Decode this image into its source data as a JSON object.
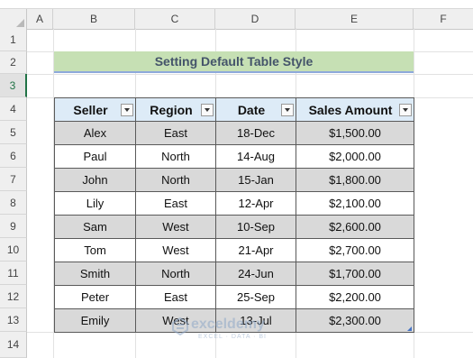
{
  "columns": [
    "A",
    "B",
    "C",
    "D",
    "E",
    "F"
  ],
  "rows": [
    "1",
    "2",
    "3",
    "4",
    "5",
    "6",
    "7",
    "8",
    "9",
    "10",
    "11",
    "12",
    "13",
    "14"
  ],
  "selected_row": "3",
  "title": "Setting Default Table Style",
  "table": {
    "headers": [
      "Seller",
      "Region",
      "Date",
      "Sales Amount"
    ],
    "records": [
      [
        "Alex",
        "East",
        "18-Dec",
        "$1,500.00"
      ],
      [
        "Paul",
        "North",
        "14-Aug",
        "$2,000.00"
      ],
      [
        "John",
        "North",
        "15-Jan",
        "$1,800.00"
      ],
      [
        "Lily",
        "East",
        "12-Apr",
        "$2,100.00"
      ],
      [
        "Sam",
        "West",
        "10-Sep",
        "$2,600.00"
      ],
      [
        "Tom",
        "West",
        "21-Apr",
        "$2,700.00"
      ],
      [
        "Smith",
        "North",
        "24-Jun",
        "$1,700.00"
      ],
      [
        "Peter",
        "East",
        "25-Sep",
        "$2,200.00"
      ],
      [
        "Emily",
        "West",
        "13-Jul",
        "$2,300.00"
      ]
    ]
  },
  "watermark": {
    "name": "exceldemy",
    "tagline": "EXCEL · DATA · BI"
  },
  "colors": {
    "title_fill": "#c6e0b4",
    "header_fill": "#ddebf7",
    "band_fill": "#d9d9d9",
    "selected_accent": "#217346"
  }
}
